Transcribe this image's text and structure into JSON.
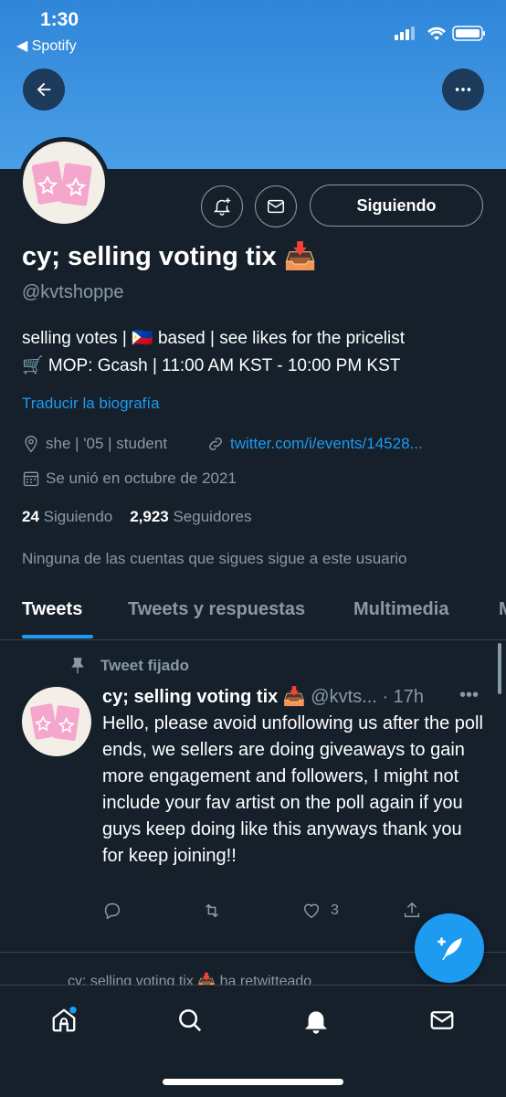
{
  "status_bar": {
    "time": "1:30",
    "back_app": "◀ Spotify"
  },
  "profile": {
    "name": "cy; selling voting tix 📥",
    "handle": "@kvtshoppe",
    "bio_line1": "selling votes | 🇵🇭 based | see likes for the pricelist",
    "bio_line2": "🛒 MOP: Gcash | 11:00 AM KST - 10:00 PM KST",
    "translate": "Traducir la biografía",
    "location": "she | '05 | student",
    "link": "twitter.com/i/events/14528...",
    "joined": "Se unió en octubre de 2021",
    "following_count": "24",
    "following_label": "Siguiendo",
    "followers_count": "2,923",
    "followers_label": "Seguidores",
    "notice": "Ninguna de las cuentas que sigues sigue a este usuario",
    "follow_button": "Siguiendo"
  },
  "tabs": [
    "Tweets",
    "Tweets y respuestas",
    "Multimedia",
    "M"
  ],
  "pinned_tweet": {
    "pinned_label": "Tweet fijado",
    "author": "cy; selling voting tix 📥",
    "handle": "@kvts...",
    "time": "· 17h",
    "more": "•••",
    "text": "Hello, please avoid unfollowing us after the poll ends, we sellers are doing giveaways to gain more engagement and followers, I might not include your fav artist on the poll again if you guys keep doing like this anyways thank you for keep joining!!",
    "likes": "3"
  },
  "next_tweet_peek": "cy; selling voting tix 📥 ha retwitteado",
  "colors": {
    "background": "#15202b",
    "accent": "#1d9bf0",
    "banner": "#3a92e0",
    "muted": "#8899a6"
  }
}
